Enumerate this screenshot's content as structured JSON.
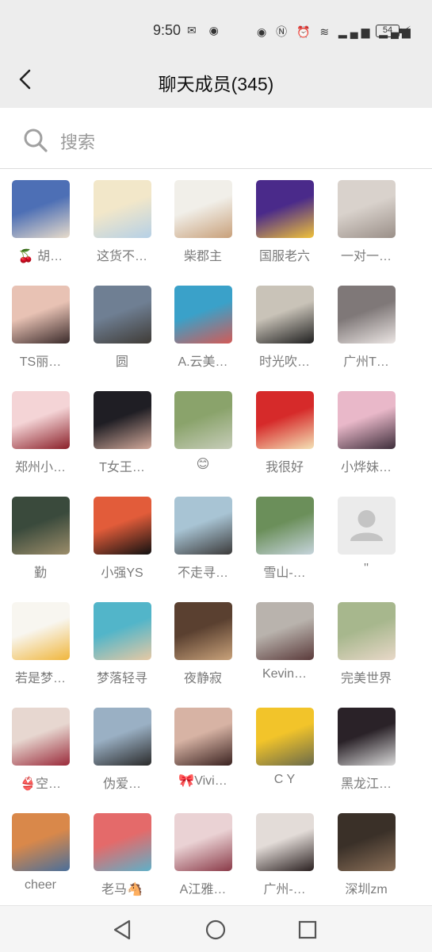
{
  "status_bar": {
    "time": "9:50",
    "left_icons": "✉ ◉",
    "right_icons": "◉ Ⓝ ⏰ ≋ ▂▄▆ ▂▄▆",
    "battery": "54",
    "charge": "⚡"
  },
  "nav": {
    "back_icon": "chevron-left-icon",
    "title": "聊天成员(345)"
  },
  "search": {
    "placeholder": "搜索",
    "icon": "search-icon"
  },
  "members": [
    {
      "name": "🍒 胡…",
      "color": "#4d6fb5",
      "color2": "#e8dccb"
    },
    {
      "name": "这货不…",
      "color": "#f2e7c9",
      "color2": "#b5d0e6"
    },
    {
      "name": "柴郡主",
      "color": "#f1efe9",
      "color2": "#c8a07a"
    },
    {
      "name": "国服老六",
      "color": "#4a2a8a",
      "color2": "#f0c23a"
    },
    {
      "name": "一对一…",
      "color": "#d9d2cc",
      "color2": "#9a8f88"
    },
    {
      "name": "TS丽…",
      "color": "#e8c2b4",
      "color2": "#3a2a2a"
    },
    {
      "name": "圆",
      "color": "#6f7f93",
      "color2": "#3f3b36"
    },
    {
      "name": "A.云美…",
      "color": "#3aa1c9",
      "color2": "#d35a56"
    },
    {
      "name": "时光吹…",
      "color": "#c9c3b8",
      "color2": "#1f1f1f"
    },
    {
      "name": "广州T…",
      "color": "#7f7878",
      "color2": "#ece6e4"
    },
    {
      "name": "郑州小…",
      "color": "#f4d4d6",
      "color2": "#8a1f28"
    },
    {
      "name": "T女王…",
      "color": "#1f1e24",
      "color2": "#d2a99a"
    },
    {
      "name": "😊",
      "color": "#8aa36b",
      "color2": "#c7cdb9"
    },
    {
      "name": "我很好",
      "color": "#d62a2a",
      "color2": "#f4e2b6"
    },
    {
      "name": "小烨妹…",
      "color": "#e9b8c9",
      "color2": "#3d2d3a"
    },
    {
      "name": "勤",
      "color": "#3a4a3c",
      "color2": "#9c8d6a"
    },
    {
      "name": "小强YS",
      "color": "#e25c3a",
      "color2": "#111111"
    },
    {
      "name": "不走寻…",
      "color": "#a8c4d4",
      "color2": "#3b3a3a"
    },
    {
      "name": "雪山-…",
      "color": "#6b8f5a",
      "color2": "#c6d4dc"
    },
    {
      "name": "''",
      "color": "#ebebeb",
      "color2": "#c4c4c4"
    },
    {
      "name": "若是梦…",
      "color": "#f8f6f0",
      "color2": "#f0b63c"
    },
    {
      "name": "梦落轻寻",
      "color": "#52b5c9",
      "color2": "#e7c9a4"
    },
    {
      "name": "夜静寂",
      "color": "#5a4030",
      "color2": "#c9a27a"
    },
    {
      "name": "Kevin…",
      "color": "#b9b3ad",
      "color2": "#5a3a3a"
    },
    {
      "name": "完美世界",
      "color": "#a7b78d",
      "color2": "#e8d8c8"
    },
    {
      "name": "👙空…",
      "color": "#e7d7d0",
      "color2": "#9a2a3a"
    },
    {
      "name": "伪爱…",
      "color": "#9ab0c4",
      "color2": "#2a2a2a"
    },
    {
      "name": "🎀Vivi…",
      "color": "#d7b3a4",
      "color2": "#3a2220"
    },
    {
      "name": "C Y",
      "color": "#f2c42a",
      "color2": "#6a6a4a"
    },
    {
      "name": "黑龙江…",
      "color": "#2a2228",
      "color2": "#d9d9d9"
    },
    {
      "name": "cheer",
      "color": "#d9884a",
      "color2": "#4a6f9a"
    },
    {
      "name": "老马🐴",
      "color": "#e46a6a",
      "color2": "#5fb0c8"
    },
    {
      "name": "A江雅…",
      "color": "#ead2d4",
      "color2": "#8a3a48"
    },
    {
      "name": "广州-…",
      "color": "#e3dcd8",
      "color2": "#2a2020"
    },
    {
      "name": "深圳zm",
      "color": "#3a3028",
      "color2": "#8a6f58"
    }
  ],
  "bottom_nav": {
    "back_icon": "triangle-back-icon",
    "home_icon": "circle-home-icon",
    "recents_icon": "square-recents-icon"
  }
}
